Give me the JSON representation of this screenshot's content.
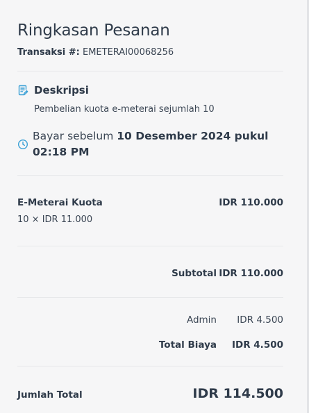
{
  "summary": {
    "title": "Ringkasan Pesanan",
    "transaction_label": "Transaksi #:",
    "transaction_id": "EMETERAI00068256"
  },
  "description": {
    "heading": "Deskripsi",
    "text": "Pembelian kuota e-meterai sejumlah 10",
    "icon": "document-edit-icon"
  },
  "payment_deadline": {
    "prefix": "Bayar sebelum",
    "deadline": "10 Desember 2024 pukul 02:18 PM",
    "icon": "clock-icon"
  },
  "item": {
    "name": "E-Meterai Kuota",
    "qty_price": "10 × IDR 11.000",
    "amount": "IDR 110.000"
  },
  "subtotal": {
    "label": "Subtotal",
    "value": "IDR 110.000"
  },
  "fees": {
    "admin_label": "Admin",
    "admin_value": "IDR 4.500",
    "total_label": "Total Biaya",
    "total_value": "IDR 4.500"
  },
  "grand_total": {
    "label": "Jumlah Total",
    "value": "IDR 114.500"
  },
  "colors": {
    "accent": "#3aa0d6",
    "text": "#2f3b4a",
    "background": "#f6f6f7"
  }
}
